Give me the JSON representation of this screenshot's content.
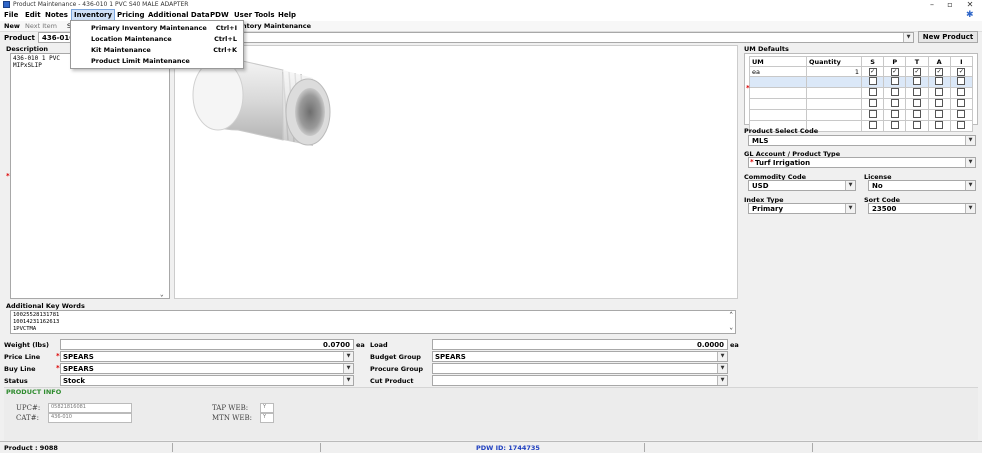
{
  "window": {
    "title": "Product Maintenance - 436-010 1 PVC S40 MALE ADAPTER",
    "controls": {
      "minimize": "–",
      "maximize": "▫",
      "close": "✕"
    }
  },
  "menu": {
    "items": [
      "File",
      "Edit",
      "Notes",
      "Inventory",
      "Pricing",
      "Additional Data",
      "PDW",
      "User Tools",
      "Help"
    ],
    "active": "Inventory"
  },
  "inventory_menu": {
    "items": [
      {
        "label": "Primary Inventory Maintenance",
        "shortcut": "Ctrl+I"
      },
      {
        "label": "Location Maintenance",
        "shortcut": "Ctrl+L"
      },
      {
        "label": "Kit Maintenance",
        "shortcut": "Ctrl+K"
      },
      {
        "label": "Product Limit Maintenance",
        "shortcut": ""
      }
    ]
  },
  "toolbar": {
    "new": "New",
    "next_item": "Next Item",
    "s": "S",
    "behind_menu": "ntory Maintenance"
  },
  "product_row": {
    "label": "Product",
    "value": "436-010",
    "new_product_button": "New Product"
  },
  "description": {
    "label": "Description",
    "text_line1": "436-010 1 PVC",
    "text_line2": "MIPxSLIP"
  },
  "um_defaults": {
    "title": "UM Defaults",
    "columns": [
      "UM",
      "Quantity",
      "S",
      "P",
      "T",
      "A",
      "I"
    ],
    "rows": [
      {
        "um": "ea",
        "quantity": "1",
        "s": true,
        "p": true,
        "t": true,
        "a": true,
        "i": true
      },
      {
        "um": "",
        "quantity": "",
        "s": false,
        "p": false,
        "t": false,
        "a": false,
        "i": false
      },
      {
        "um": "",
        "quantity": "",
        "s": false,
        "p": false,
        "t": false,
        "a": false,
        "i": false
      },
      {
        "um": "",
        "quantity": "",
        "s": false,
        "p": false,
        "t": false,
        "a": false,
        "i": false
      },
      {
        "um": "",
        "quantity": "",
        "s": false,
        "p": false,
        "t": false,
        "a": false,
        "i": false
      },
      {
        "um": "",
        "quantity": "",
        "s": false,
        "p": false,
        "t": false,
        "a": false,
        "i": false
      }
    ]
  },
  "product_select_code": {
    "label": "Product Select Code",
    "value": "MLS"
  },
  "gl_account": {
    "label": "GL Account / Product Type",
    "value": "Turf Irrigation"
  },
  "commodity_code": {
    "label": "Commodity Code",
    "value": "USD"
  },
  "license": {
    "label": "License",
    "value": "No"
  },
  "index_type": {
    "label": "Index Type",
    "value": "Primary"
  },
  "sort_code": {
    "label": "Sort Code",
    "value": "23500"
  },
  "keywords": {
    "label": "Additional Key Words",
    "lines": [
      "10025528131781",
      "10014231162613",
      "1PVCTMA"
    ]
  },
  "weight": {
    "label": "Weight (lbs)",
    "value": "0.0700",
    "unit": "ea"
  },
  "load": {
    "label": "Load",
    "value": "0.0000",
    "unit": "ea"
  },
  "price_line": {
    "label": "Price Line",
    "value": "SPEARS"
  },
  "buy_line": {
    "label": "Buy Line",
    "value": "SPEARS"
  },
  "status": {
    "label": "Status",
    "value": "Stock"
  },
  "budget_group": {
    "label": "Budget Group",
    "value": "SPEARS"
  },
  "procure_group": {
    "label": "Procure Group",
    "value": ""
  },
  "cut_product": {
    "label": "Cut Product",
    "value": ""
  },
  "product_info": {
    "label": "PRODUCT INFO",
    "upc_label": "UPC#:",
    "upc_value": "05821816081",
    "cat_label": "CAT#:",
    "cat_value": "436-010",
    "tap_label": "TAP WEB:",
    "tap_value": "Y",
    "mtn_label": "MTN WEB:",
    "mtn_value": "Y"
  },
  "statusbar": {
    "product": "Product : 9088",
    "pdw_id": "PDW ID: 1744735"
  },
  "colors": {
    "menu_highlight": "#cfe0f7",
    "required": "#dd0000",
    "product_info": "#2e8b2e",
    "status_blue": "#2040c0"
  }
}
